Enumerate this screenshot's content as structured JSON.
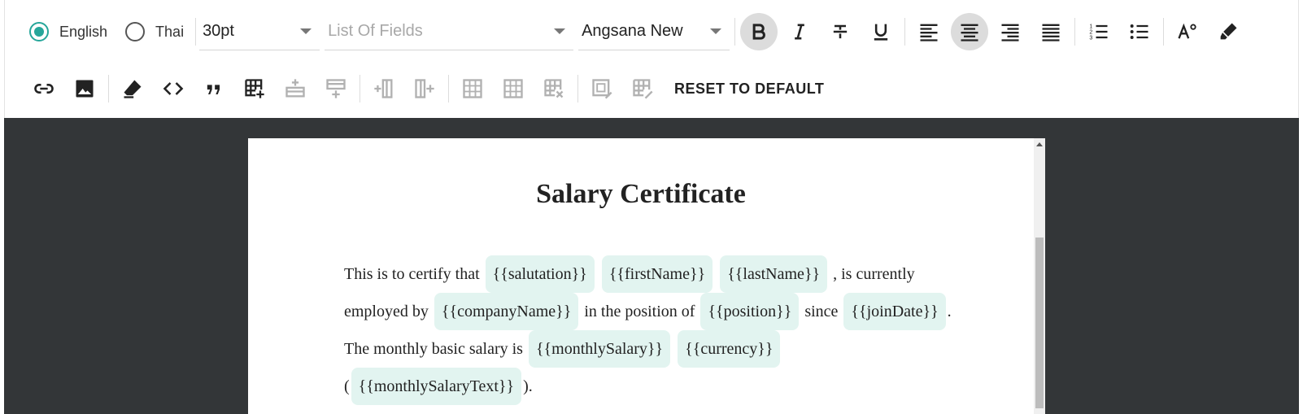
{
  "language": {
    "options": [
      {
        "label": "English",
        "checked": true
      },
      {
        "label": "Thai",
        "checked": false
      }
    ]
  },
  "font_size": {
    "value": "30pt"
  },
  "field_select": {
    "placeholder": "List Of Fields"
  },
  "font_family": {
    "value": "Angsana New"
  },
  "reset_label": "RESET TO DEFAULT",
  "accent_color": "#26a69a",
  "document": {
    "title": "Salary Certificate",
    "line1": {
      "text1": "This is to certify that",
      "f1": "{{salutation}}",
      "f2": "{{firstName}}",
      "f3": "{{lastName}}",
      "text2": ", is currently"
    },
    "line2": {
      "text1": "employed by",
      "f1": "{{companyName}}",
      "text2": "in the position of",
      "f2": "{{position}}",
      "text3": "since",
      "f3": "{{joinDate}}",
      "text4": "."
    },
    "line3": {
      "text1": "The monthly basic salary is",
      "f1": "{{monthlySalary}}",
      "f2": "{{currency}}"
    },
    "line4": {
      "text1": "(",
      "f1": "{{monthlySalaryText}}",
      "text2": ")."
    }
  }
}
